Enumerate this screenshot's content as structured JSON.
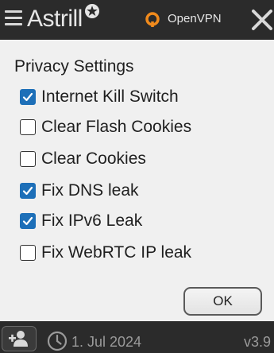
{
  "header": {
    "brand": "Astrill",
    "protocol_label": "OpenVPN"
  },
  "settings": {
    "title": "Privacy Settings",
    "options": [
      {
        "label": "Internet Kill Switch",
        "checked": true
      },
      {
        "label": "Clear Flash Cookies",
        "checked": false
      },
      {
        "label": "Clear Cookies",
        "checked": false
      },
      {
        "label": "Fix DNS leak",
        "checked": true
      },
      {
        "label": "Fix IPv6 Leak",
        "checked": true
      },
      {
        "label": "Fix WebRTC IP leak",
        "checked": false
      }
    ],
    "ok_label": "OK"
  },
  "footer": {
    "date": "1. Jul 2024",
    "version": "v3.9"
  },
  "colors": {
    "titlebar_bg": "#2b2b2b",
    "panel_bg": "#f0f0f0",
    "checkbox_accent": "#1d6fb8",
    "openvpn_orange": "#f08a1c"
  },
  "icons": [
    "menu-icon",
    "star-icon",
    "openvpn-icon",
    "close-icon",
    "add-user-icon",
    "clock-icon",
    "check-icon"
  ]
}
